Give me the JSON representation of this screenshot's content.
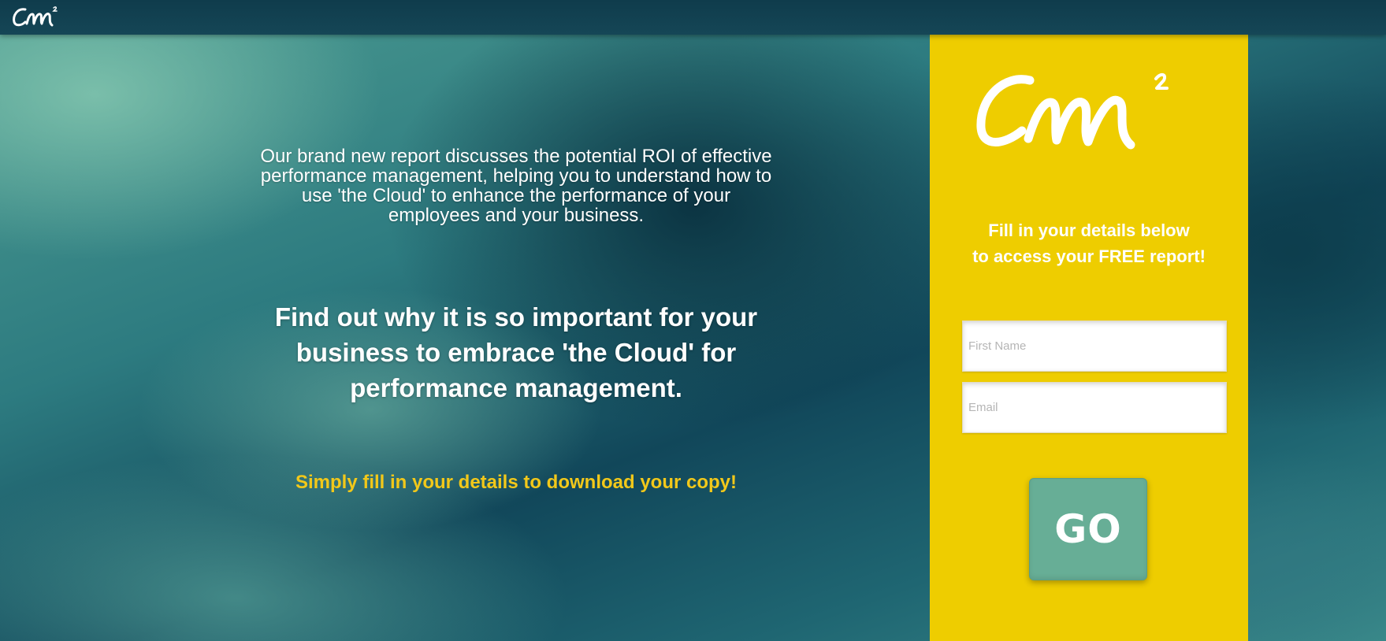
{
  "brand": {
    "logo_text": "cm2"
  },
  "main": {
    "intro": "Our brand new report discusses the potential ROI of effective performance management, helping you to understand how to use 'the Cloud' to enhance the performance of your employees and your business.",
    "headline": "Find out why it is so important for your business to embrace 'the Cloud' for performance management.",
    "cta": "Simply fill in your details to download your copy!"
  },
  "form": {
    "heading_line1": "Fill in your details below",
    "heading_line2": "to access your FREE report!",
    "first_name_placeholder": "First Name",
    "first_name_value": "",
    "email_placeholder": "Email",
    "email_value": "",
    "submit_label": "GO"
  },
  "colors": {
    "panel": "#eecd00",
    "button": "#67ae96",
    "cta_text": "#f2c81a",
    "topbar": "#154656"
  }
}
